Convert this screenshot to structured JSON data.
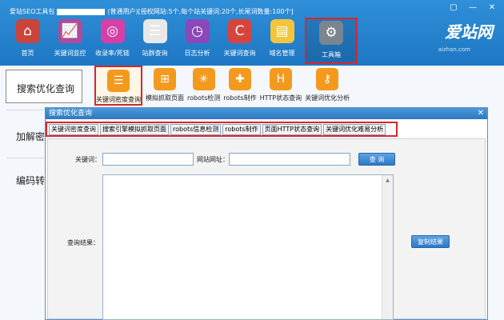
{
  "window": {
    "title_prefix": "爱站SEO工具包",
    "title_suffix": "(普通用户)[授权网站:5个,每个站关键词:20个,长尾词数量:100个]",
    "controls": [
      "▢",
      "—",
      "✕"
    ]
  },
  "toolbar": {
    "items": [
      {
        "label": "首页",
        "icon": "home-icon",
        "glyph": "⌂",
        "color": "#c9453b"
      },
      {
        "label": "关键词监控",
        "icon": "chart-icon",
        "glyph": "📈",
        "color": "#b04a9a"
      },
      {
        "label": "收录率/死链",
        "icon": "target-icon",
        "glyph": "◎",
        "color": "#d53fa6"
      },
      {
        "label": "站群查询",
        "icon": "list-icon",
        "glyph": "☰",
        "color": "#e8e8e8"
      },
      {
        "label": "日志分析",
        "icon": "clock-icon",
        "glyph": "◷",
        "color": "#8a48b8"
      },
      {
        "label": "关键词查询",
        "icon": "search-c-icon",
        "glyph": "C",
        "color": "#d7443e"
      },
      {
        "label": "域名管理",
        "icon": "notes-icon",
        "glyph": "▤",
        "color": "#f2c53d"
      },
      {
        "label": "工具箱",
        "icon": "gear-icon",
        "glyph": "⚙",
        "color": "#7a8590"
      }
    ]
  },
  "brand": {
    "name": "爱站网",
    "sub": "aizhan.com"
  },
  "left_menu": {
    "items": [
      "搜索优化查询",
      "加解密",
      "编码转"
    ]
  },
  "sub_tools": {
    "items": [
      {
        "label": "关键词密度查询",
        "icon": "list-icon",
        "glyph": "☰",
        "color": "#f39a1e"
      },
      {
        "label": "模拟抓取页面",
        "icon": "sitemap-icon",
        "glyph": "⊞",
        "color": "#f39a1e"
      },
      {
        "label": "robots检测",
        "icon": "spider-icon",
        "glyph": "✳",
        "color": "#f39a1e"
      },
      {
        "label": "robots制作",
        "icon": "file-plus-icon",
        "glyph": "✚",
        "color": "#f39a1e"
      },
      {
        "label": "HTTP状态查询",
        "icon": "http-icon",
        "glyph": "H",
        "color": "#f39a1e"
      },
      {
        "label": "关键词优化分析",
        "icon": "key-icon",
        "glyph": "⚷",
        "color": "#f39a1e"
      }
    ]
  },
  "dialog": {
    "title": "搜索优化查询",
    "close": "✕",
    "tabs": [
      "关键词密度查询",
      "搜索引擎模拟抓取页面",
      "robots信息检测",
      "robots制作",
      "页面HTTP状态查询",
      "关键词优化难易分析"
    ],
    "keyword_label": "关键词：",
    "keyword_value": "",
    "site_label": "网站网址：",
    "site_value": "",
    "query_button": "查 询",
    "result_label": "查询结果：",
    "result_value": "",
    "copy_button": "复制结果"
  }
}
